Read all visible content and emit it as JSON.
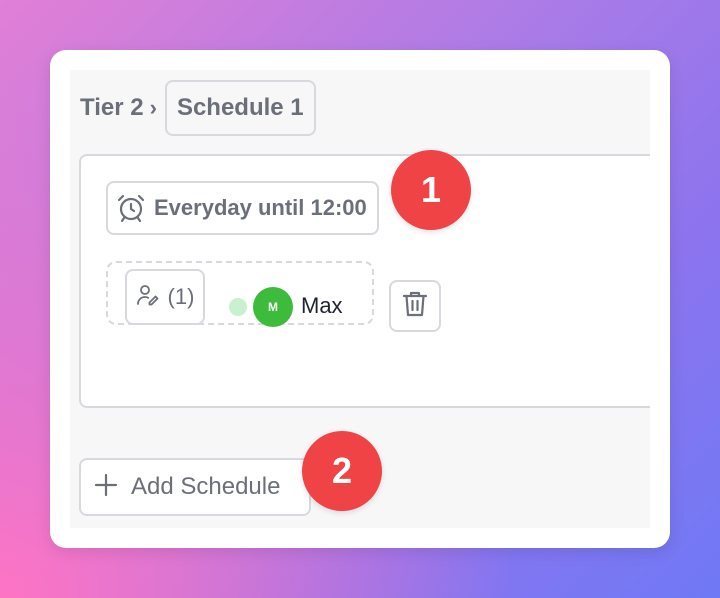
{
  "breadcrumb": {
    "tier": "Tier 2",
    "separator": "›",
    "schedule": "Schedule 1"
  },
  "schedule": {
    "time_label": "Everyday until 12:00",
    "time_icon": "alarm-clock-icon",
    "assignee_count": "(1)",
    "assignees": [
      {
        "initial": "M",
        "name": "Max",
        "avatar_color": "#3dbb3a",
        "status_color": "#c9f0d1"
      }
    ],
    "delete_icon": "trash-icon"
  },
  "add_schedule": {
    "label": "Add Schedule",
    "icon": "plus-icon"
  },
  "markers": [
    {
      "label": "1"
    },
    {
      "label": "2"
    }
  ],
  "colors": {
    "marker": "#ef4346",
    "border": "#d7d9de",
    "muted_text": "#6b6f79"
  }
}
